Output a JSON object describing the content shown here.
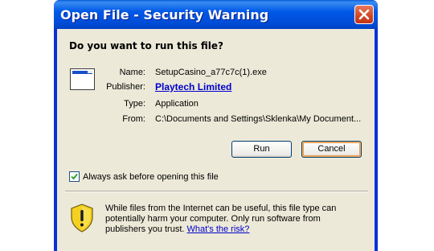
{
  "window": {
    "title": "Open File - Security Warning"
  },
  "dialog": {
    "question": "Do you want to run this file?",
    "fields": [
      {
        "label": "Name:",
        "value": "SetupCasino_a77c7c(1).exe"
      },
      {
        "label": "Publisher:",
        "value": "Playtech Limited"
      },
      {
        "label": "Type:",
        "value": "Application"
      },
      {
        "label": "From:",
        "value": "C:\\Documents and Settings\\Sklenka\\My Document..."
      }
    ],
    "buttons": {
      "run": "Run",
      "cancel": "Cancel"
    },
    "checkbox": {
      "label": "Always ask before opening this file",
      "checked": true
    },
    "warning": {
      "text": "While files from the Internet can be useful, this file type can potentially harm your computer. Only run software from publishers you trust.",
      "link": "What's the risk?"
    }
  },
  "icons": {
    "close": "close-icon",
    "file": "application-file-icon",
    "shield": "security-shield-icon",
    "check": "checkmark-icon"
  },
  "colors": {
    "titlebar": "#0058e6",
    "dialog_bg": "#ece9d8",
    "link": "#0000cc",
    "close_button": "#d2461f",
    "shield_yellow": "#f5d020"
  }
}
